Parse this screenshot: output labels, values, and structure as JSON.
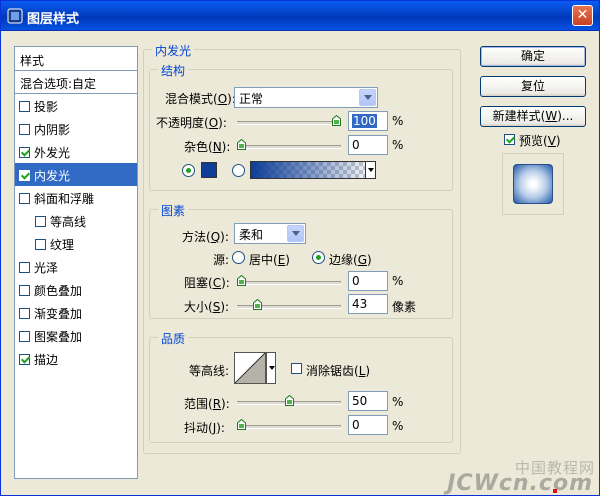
{
  "window": {
    "title": "图层样式",
    "close_glyph": "✕"
  },
  "styles_list": {
    "header": "样式",
    "blend_options": "混合选项:自定",
    "items": [
      {
        "label": "投影",
        "checked": false
      },
      {
        "label": "内阴影",
        "checked": false
      },
      {
        "label": "外发光",
        "checked": true
      },
      {
        "label": "内发光",
        "checked": true,
        "selected": true
      },
      {
        "label": "斜面和浮雕",
        "checked": false
      },
      {
        "label": "等高线",
        "checked": false,
        "sub": true
      },
      {
        "label": "纹理",
        "checked": false,
        "sub": true
      },
      {
        "label": "光泽",
        "checked": false
      },
      {
        "label": "颜色叠加",
        "checked": false
      },
      {
        "label": "渐变叠加",
        "checked": false
      },
      {
        "label": "图案叠加",
        "checked": false
      },
      {
        "label": "描边",
        "checked": true
      }
    ]
  },
  "panel": {
    "title": "内发光",
    "structure": {
      "title": "结构",
      "blend_mode_label": "混合模式(",
      "blend_mode_key": "O",
      "blend_mode_value": "正常",
      "opacity_label": "不透明度(",
      "opacity_key": "O",
      "opacity_value": "100",
      "opacity_level": 100,
      "noise_label": "杂色(",
      "noise_key": "N",
      "noise_value": "0",
      "noise_level": 0,
      "percent": "%",
      "glow_color": "#0e3d97"
    },
    "elements": {
      "title": "图素",
      "method_label": "方法(",
      "method_key": "Q",
      "method_value": "柔和",
      "source_label": "源:",
      "center_label": "居中(",
      "center_key": "E",
      "edge_label": "边缘(",
      "edge_key": "G",
      "choke_label": "阻塞(",
      "choke_key": "C",
      "choke_value": "0",
      "choke_level": 0,
      "size_label": "大小(",
      "size_key": "S",
      "size_value": "43",
      "size_level": 17,
      "percent": "%",
      "px_unit": "像素"
    },
    "quality": {
      "title": "品质",
      "contour_label": "等高线:",
      "antialias_label": "消除锯齿(",
      "antialias_key": "L",
      "range_label": "范围(",
      "range_key": "R",
      "range_value": "50",
      "range_level": 50,
      "jitter_label": "抖动(",
      "jitter_key": "J",
      "jitter_value": "0",
      "jitter_level": 0,
      "percent": "%"
    }
  },
  "buttons": {
    "ok": "确定",
    "reset": "复位",
    "new_style_prefix": "新建样式(",
    "new_style_key": "W",
    "new_style_suffix": ")...",
    "preview_label": "预览(",
    "preview_key": "V"
  },
  "watermark": {
    "cn": "中国教程网",
    "en": "JCWcn.com"
  },
  "paren_close": "):",
  "paren_close_plain": ")",
  "colors": {
    "accent": "#0046d5",
    "selection": "#316ac5",
    "titlebar": "#0441c7"
  }
}
